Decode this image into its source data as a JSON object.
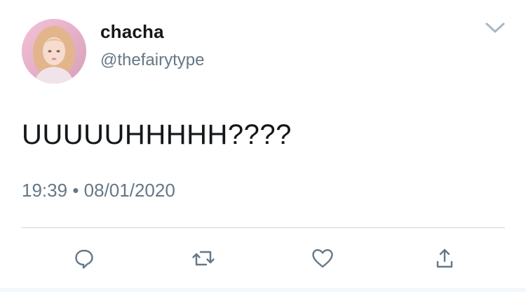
{
  "tweet": {
    "author": {
      "name": "chacha",
      "handle": "@thefairytype"
    },
    "text": "UUUUUHHHHH????",
    "time": "19:39",
    "separator": "•",
    "date": "08/01/2020"
  },
  "actions": [
    {
      "icon": "reply-icon"
    },
    {
      "icon": "retweet-icon"
    },
    {
      "icon": "like-icon"
    },
    {
      "icon": "share-icon"
    }
  ],
  "colors": {
    "text": "#14171a",
    "secondary": "#657786",
    "divider": "#d0d4d8",
    "icon": "#657786"
  }
}
